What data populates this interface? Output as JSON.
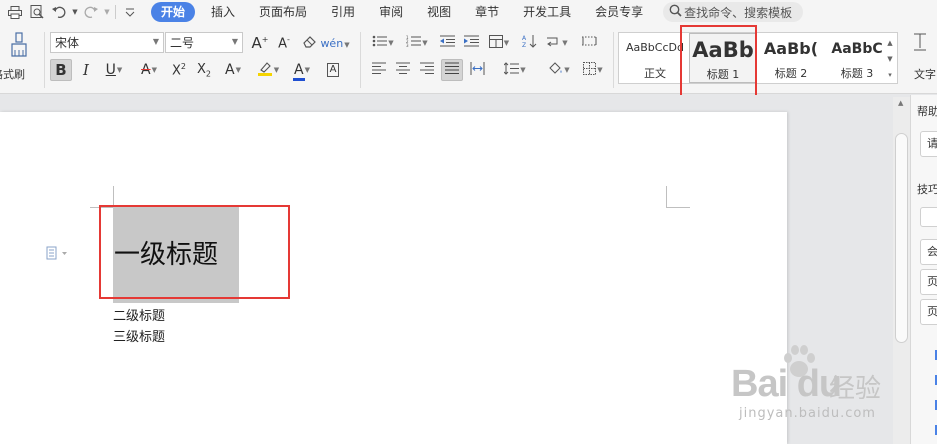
{
  "menubar": {
    "tabs": [
      "开始",
      "插入",
      "页面布局",
      "引用",
      "审阅",
      "视图",
      "章节",
      "开发工具",
      "会员专享"
    ],
    "search_placeholder": "查找命令、搜索模板"
  },
  "ribbon": {
    "format_painter_label": "格式刷",
    "font_name": "宋体",
    "font_size": "二号",
    "styles": [
      {
        "preview": "AaBbCcDd",
        "name": "正文"
      },
      {
        "preview": "AaBb",
        "name": "标题 1"
      },
      {
        "preview": "AaBb(",
        "name": "标题 2"
      },
      {
        "preview": "AaBbC",
        "name": "标题 3"
      }
    ],
    "right_tool_label": "文字"
  },
  "document": {
    "heading1": "一级标题",
    "heading2": "二级标题",
    "heading3": "三级标题"
  },
  "help_pane": {
    "title": "帮助",
    "input_hint": "请",
    "section": "技巧",
    "buttons": [
      "会",
      "页",
      "页"
    ]
  },
  "watermark": {
    "logo": "Bai du",
    "cn": "经验",
    "url": "jingyan.baidu.com"
  },
  "colors": {
    "accent": "#4a82e6",
    "highlight_box": "#e53935",
    "selection_bg": "#c8c8c8",
    "font_color_bar": "#1f4fd1",
    "highlight_color_bar": "#f5d400",
    "strike_color": "#e53935"
  }
}
